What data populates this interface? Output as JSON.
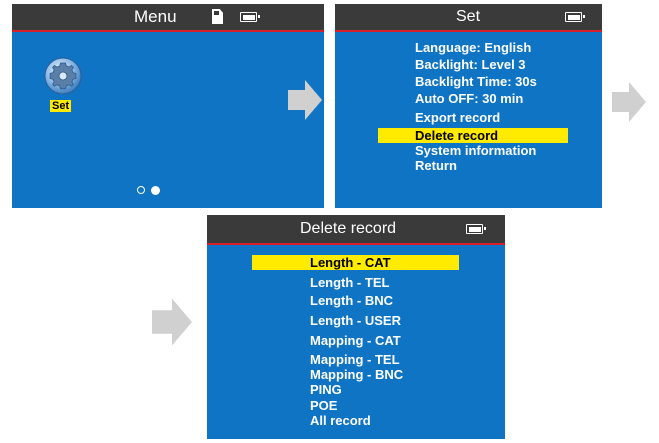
{
  "colors": {
    "screen_bg": "#0f74c4",
    "titlebar_bg": "#3a3a3a",
    "titlebar_border": "#d8202a",
    "highlight": "#ffeb00",
    "arrow": "#d0d0d0"
  },
  "menu_screen": {
    "title": "Menu",
    "icons": [
      "sd-card-icon",
      "battery-icon",
      "gear-icon"
    ],
    "app_label": "Set",
    "page_dots": 2,
    "active_page": 2
  },
  "set_screen": {
    "title": "Set",
    "items": [
      "Language: English",
      "Backlight: Level 3",
      "Backlight Time: 30s",
      "Auto OFF: 30 min",
      "Export record",
      "Delete record",
      "System information",
      "Return"
    ],
    "selected": "Delete record"
  },
  "delete_screen": {
    "title": "Delete record",
    "items": [
      "Length - CAT",
      "Length - TEL",
      "Length - BNC",
      "Length - USER",
      "Mapping - CAT",
      "Mapping - TEL",
      "Mapping - BNC",
      "PING",
      "POE",
      "All record"
    ],
    "selected": "Length - CAT"
  }
}
